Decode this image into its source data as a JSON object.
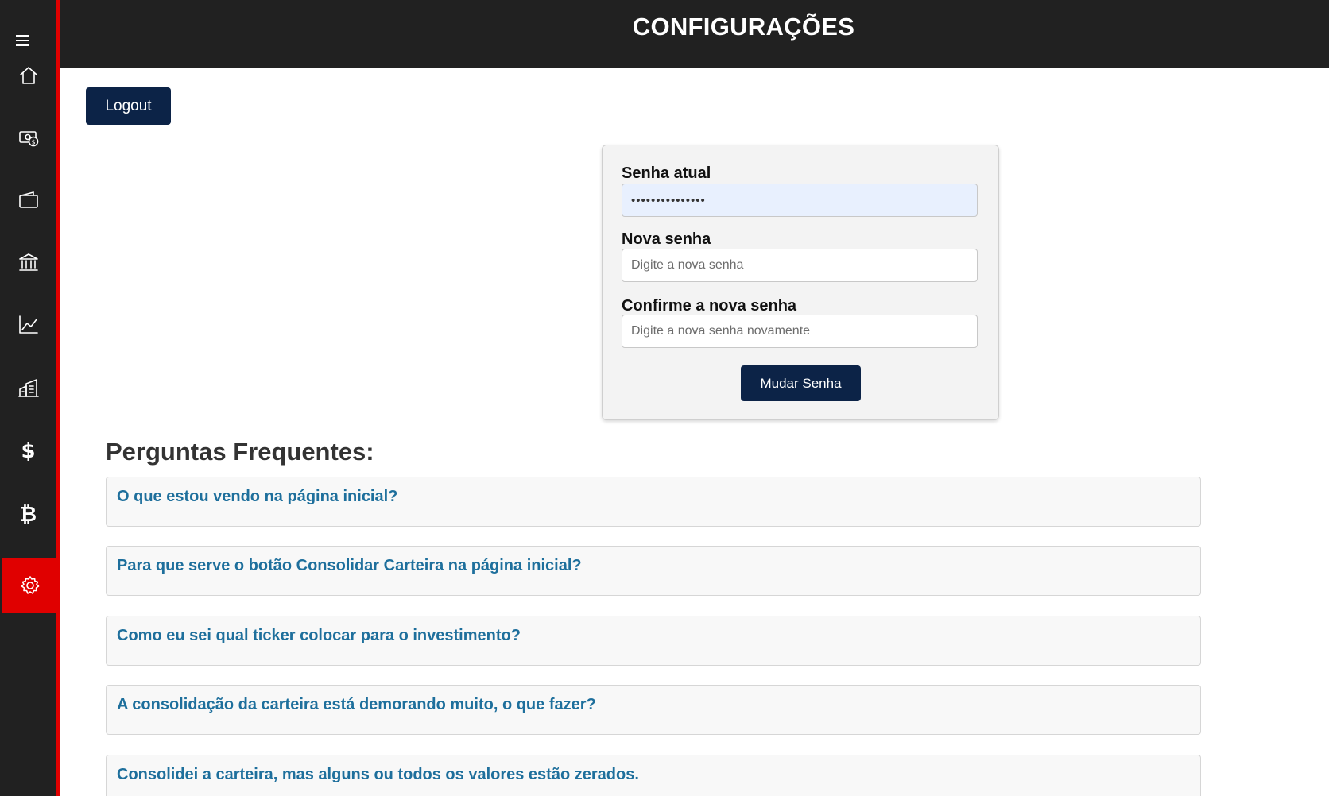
{
  "header": {
    "title": "CONFIGURAÇÕES"
  },
  "sidebar": {
    "items": [
      {
        "name": "home",
        "icon": "home-icon"
      },
      {
        "name": "cash",
        "icon": "money-icon"
      },
      {
        "name": "wallet",
        "icon": "wallet-icon"
      },
      {
        "name": "bank",
        "icon": "bank-icon"
      },
      {
        "name": "chart",
        "icon": "line-chart-icon"
      },
      {
        "name": "buildings",
        "icon": "buildings-icon"
      },
      {
        "name": "dollar",
        "icon": "dollar-icon",
        "glyph": "$"
      },
      {
        "name": "bitcoin",
        "icon": "bitcoin-icon",
        "glyph": "₿"
      },
      {
        "name": "settings",
        "icon": "gear-icon",
        "active": true
      }
    ],
    "accent": "#e00000",
    "background": "#212121"
  },
  "logout": {
    "label": "Logout"
  },
  "password_form": {
    "current": {
      "label": "Senha atual",
      "value": "•••••••••••••••"
    },
    "new": {
      "label": "Nova senha",
      "placeholder": "Digite a nova senha"
    },
    "confirm": {
      "label": "Confirme a nova senha",
      "placeholder": "Digite a nova senha novamente"
    },
    "submit_label": "Mudar Senha"
  },
  "faq": {
    "title": "Perguntas Frequentes:",
    "questions": [
      "O que estou vendo na página inicial?",
      "Para que serve o botão Consolidar Carteira na página inicial?",
      "Como eu sei qual ticker colocar para o investimento?",
      "A consolidação da carteira está demorando muito, o que fazer?",
      "Consolidei a carteira, mas alguns ou todos os valores estão zerados."
    ]
  },
  "colors": {
    "primary_button": "#0c2347",
    "faq_link": "#1e6f9c"
  }
}
